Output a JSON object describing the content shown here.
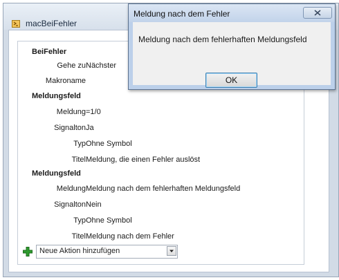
{
  "macro": {
    "tab_title": "macBeiFehler",
    "sections": [
      {
        "heading": "BeiFehler",
        "rows": [
          {
            "label": "Gehe zu",
            "value": "Nächster"
          },
          {
            "label": "Makroname",
            "value": ""
          }
        ]
      },
      {
        "heading": "Meldungsfeld",
        "rows": [
          {
            "label": "Meldung",
            "value": "=1/0"
          },
          {
            "label": "Signalton",
            "value": "Ja"
          },
          {
            "label": "Typ",
            "value": "Ohne Symbol"
          },
          {
            "label": "Titel",
            "value": "Meldung, die einen Fehler auslöst"
          }
        ]
      },
      {
        "heading": "Meldungsfeld",
        "rows": [
          {
            "label": "Meldung",
            "value": "Meldung nach dem fehlerhaften Meldungsfeld"
          },
          {
            "label": "Signalton",
            "value": "Nein"
          },
          {
            "label": "Typ",
            "value": "Ohne Symbol"
          },
          {
            "label": "Titel",
            "value": "Meldung nach dem Fehler"
          }
        ]
      }
    ],
    "add_action_placeholder": "Neue Aktion hinzufügen"
  },
  "dialog": {
    "title": "Meldung nach dem Fehler",
    "message": "Meldung nach dem fehlerhaften Meldungsfeld",
    "ok_label": "OK"
  },
  "icons": {
    "macro_tab_icon": "macro-icon",
    "add_icon": "plus-icon",
    "dropdown_icon": "chevron-down-icon",
    "close_icon": "close-icon"
  },
  "colors": {
    "plus_green": "#2e9b2e",
    "dialog_frame": "#bcd0ea",
    "ok_border": "#3c7fb1"
  }
}
